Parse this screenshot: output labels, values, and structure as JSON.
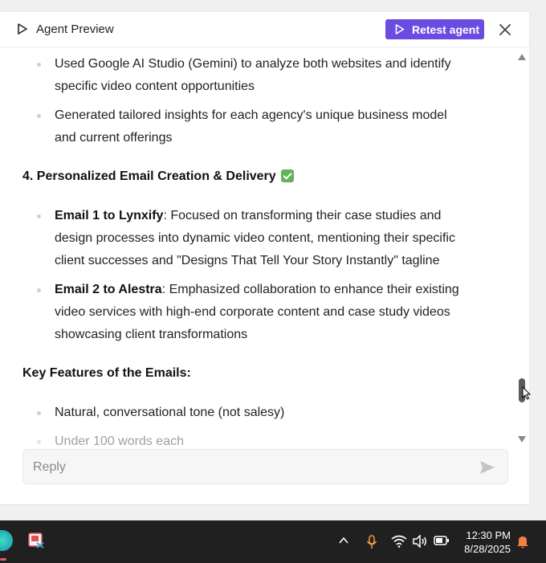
{
  "header": {
    "title": "Agent Preview",
    "retest_label": "Retest agent"
  },
  "content": {
    "bullets_top": [
      {
        "lines": [
          "Used Google AI Studio (Gemini) to analyze both websites and identify",
          "specific video content opportunities"
        ]
      },
      {
        "lines": [
          "Generated tailored insights for each agency's unique business model",
          "and current offerings"
        ]
      }
    ],
    "section4_heading": "4. Personalized Email Creation & Delivery",
    "emails": [
      {
        "bold": "Email 1 to Lynxify",
        "line1_rest": ": Focused on transforming their case studies and",
        "line2": "design processes into dynamic video content, mentioning their specific",
        "line3": "client successes and \"Designs That Tell Your Story Instantly\" tagline"
      },
      {
        "bold": "Email 2 to Alestra",
        "line1_rest": ": Emphasized collaboration to enhance their existing",
        "line2": "video services with high-end corporate content and case study videos",
        "line3": "showcasing client transformations"
      }
    ],
    "features_heading": "Key Features of the Emails:",
    "features": [
      "Natural, conversational tone (not salesy)",
      "Under 100 words each"
    ]
  },
  "reply": {
    "placeholder": "Reply"
  },
  "taskbar": {
    "time": "12:30 PM",
    "date": "8/28/2025"
  },
  "colors": {
    "accent": "#6c4ce0",
    "check": "#62b35b",
    "taskbar": "#202020"
  }
}
